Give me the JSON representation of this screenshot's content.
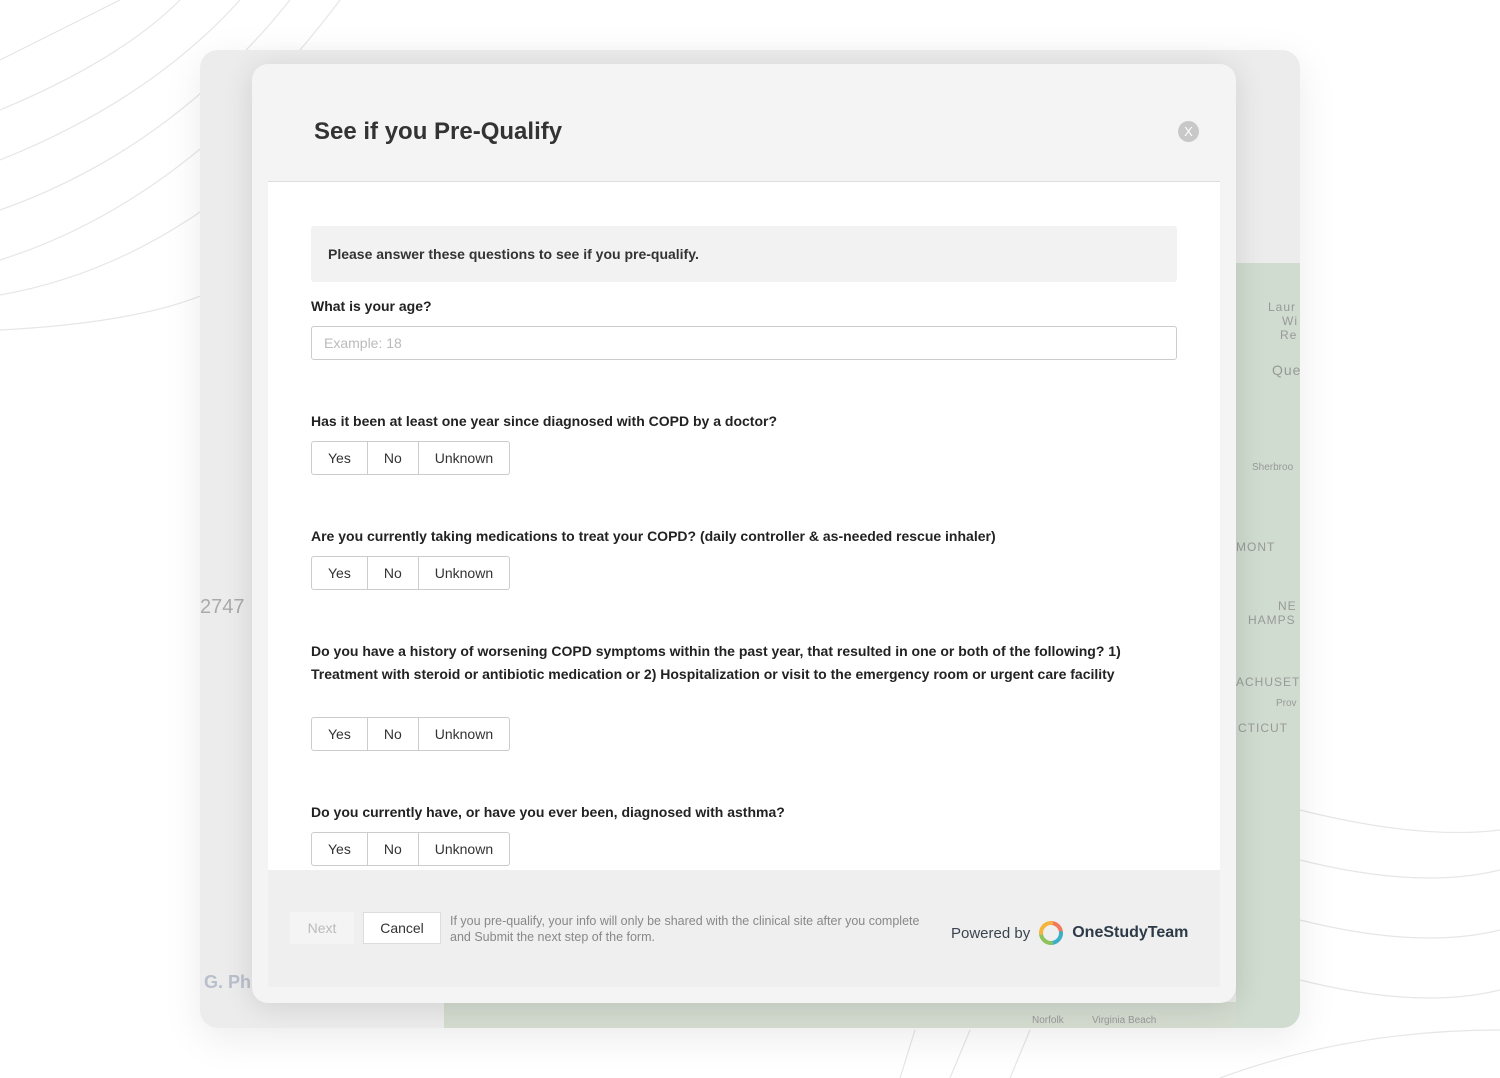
{
  "background": {
    "left_number": "2747",
    "bottom_left": "G. Ph",
    "map_labels": [
      "Laur",
      "Wi",
      "Re",
      "Que",
      "Sherbroo",
      "MONT",
      "NE",
      "HAMPS",
      "ACHUSET",
      "Prov",
      "CTICUT",
      "Norfolk",
      "Virginia Beach"
    ]
  },
  "modal": {
    "title": "See if you Pre-Qualify",
    "close_label": "X",
    "intro": "Please answer these questions to see if you pre-qualify.",
    "age": {
      "label": "What is your age?",
      "placeholder": "Example: 18",
      "value": ""
    },
    "questions": [
      {
        "text": "Has it been at least one year since diagnosed with COPD by a doctor?",
        "options": [
          "Yes",
          "No",
          "Unknown"
        ]
      },
      {
        "text": "Are you currently taking medications to treat your COPD? (daily controller & as-needed rescue inhaler)",
        "options": [
          "Yes",
          "No",
          "Unknown"
        ]
      },
      {
        "text": "Do you have a history of worsening COPD symptoms within the past year, that resulted in one or both of the following? 1) Treatment with steroid or antibiotic medication or 2) Hospitalization or visit to the emergency room or urgent care facility",
        "options": [
          "Yes",
          "No",
          "Unknown"
        ]
      },
      {
        "text": "Do you currently have, or have you ever been, diagnosed with asthma?",
        "options": [
          "Yes",
          "No",
          "Unknown"
        ]
      }
    ],
    "footer": {
      "next": "Next",
      "cancel": "Cancel",
      "note": "If you pre-qualify, your info will only be shared with the clinical site after you complete and Submit the next step of the form.",
      "powered_by": "Powered by",
      "brand": "OneStudyTeam"
    }
  }
}
